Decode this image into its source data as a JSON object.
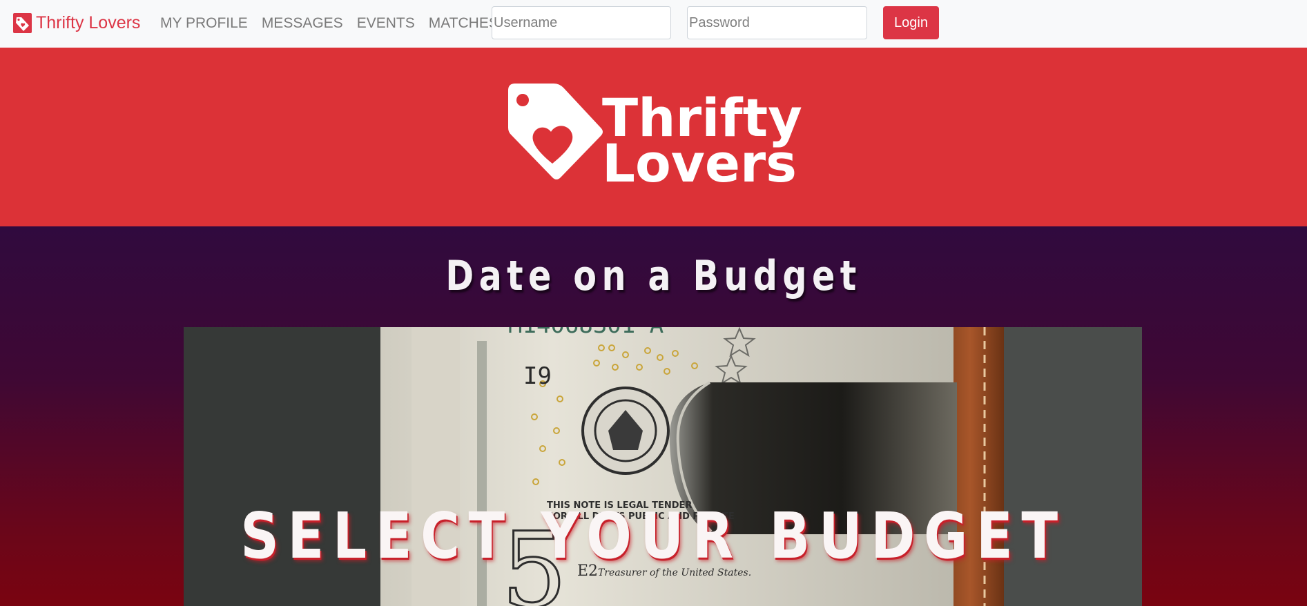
{
  "navbar": {
    "brand": "Thrifty Lovers",
    "links": [
      "MY PROFILE",
      "MESSAGES",
      "EVENTS",
      "MATCHES"
    ],
    "username_placeholder": "Username",
    "password_placeholder": "Password",
    "login_label": "Login"
  },
  "banner": {
    "logo_line1": "Thrifty",
    "logo_line2": "Lovers"
  },
  "main": {
    "headline": "Date on a Budget",
    "photo_caption": "SELECT YOUR BUDGET"
  },
  "colors": {
    "brand_red": "#dc3545",
    "banner_red": "#dc3237",
    "navbar_bg": "#f8f9fa",
    "gradient_top": "#300a3e",
    "gradient_bottom": "#7a0410"
  },
  "icons": {
    "brand_icon": "price-tag-heart-icon",
    "logo_icon": "price-tag-heart-icon"
  }
}
